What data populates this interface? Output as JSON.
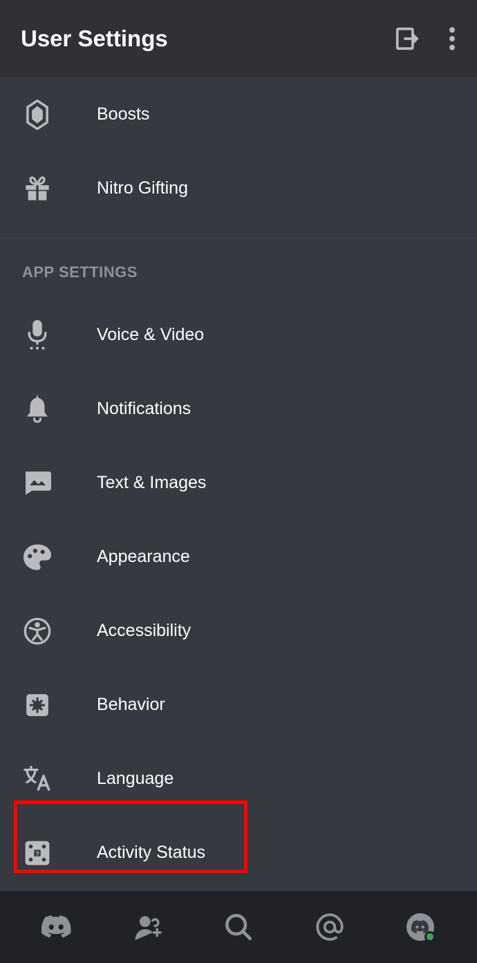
{
  "header": {
    "title": "User Settings"
  },
  "nitro": {
    "items": [
      {
        "label": "Boosts"
      },
      {
        "label": "Nitro Gifting"
      }
    ]
  },
  "section_app": {
    "heading": "APP SETTINGS",
    "items": [
      {
        "label": "Voice & Video"
      },
      {
        "label": "Notifications"
      },
      {
        "label": "Text & Images"
      },
      {
        "label": "Appearance"
      },
      {
        "label": "Accessibility"
      },
      {
        "label": "Behavior"
      },
      {
        "label": "Language"
      },
      {
        "label": "Activity Status"
      }
    ]
  },
  "highlight": {
    "target": "activity-status"
  }
}
